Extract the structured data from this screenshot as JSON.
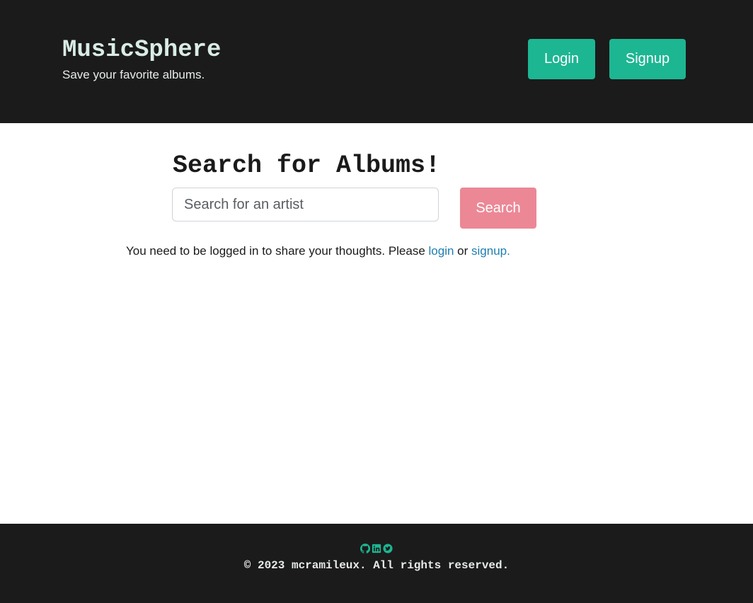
{
  "header": {
    "title": "MusicSphere",
    "tagline": "Save your favorite albums.",
    "login_label": "Login",
    "signup_label": "Signup"
  },
  "search": {
    "title": "Search for Albums!",
    "placeholder": "Search for an artist",
    "value": "",
    "button_label": "Search"
  },
  "notice": {
    "text": "You need to be logged in to share your thoughts. Please ",
    "login_link": "login",
    "or_text": " or ",
    "signup_link": "signup."
  },
  "footer": {
    "icons": [
      "github-icon",
      "linkedin-icon",
      "twitter-icon"
    ],
    "copyright": "© 2023 mcramileux. All rights reserved."
  },
  "colors": {
    "background_dark": "#1b1b1b",
    "accent_green": "#1db692",
    "search_button": "#ec8896",
    "link": "#1e7fb0"
  }
}
